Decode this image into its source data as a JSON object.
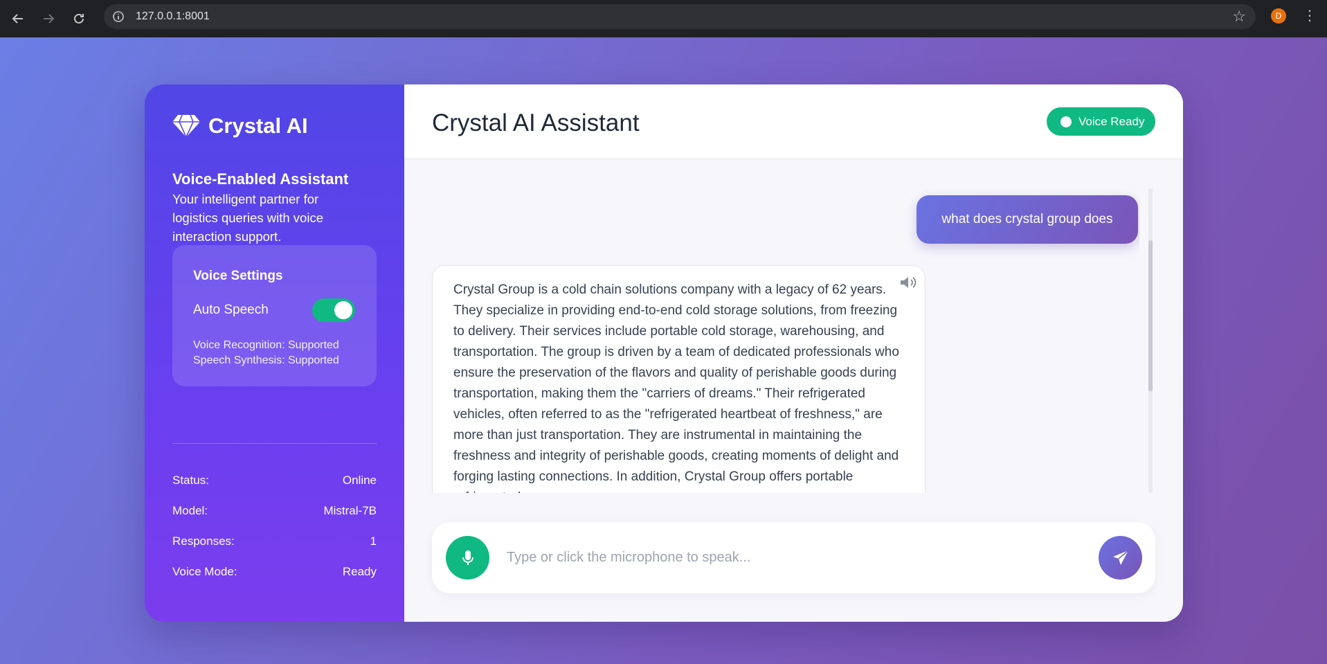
{
  "browser": {
    "url": "127.0.0.1:8001",
    "profile_initial": "D"
  },
  "sidebar": {
    "brand": "Crystal AI",
    "tagline_title": "Voice-Enabled Assistant",
    "tagline_desc": "Your intelligent partner for logistics queries with voice interaction support.",
    "voice_settings": {
      "title": "Voice Settings",
      "auto_speech_label": "Auto Speech",
      "auto_speech_on": true,
      "recognition_status": "Voice Recognition: Supported",
      "synthesis_status": "Speech Synthesis: Supported"
    },
    "stats": [
      {
        "label": "Status:",
        "value": "Online"
      },
      {
        "label": "Model:",
        "value": "Mistral-7B"
      },
      {
        "label": "Responses:",
        "value": "1"
      },
      {
        "label": "Voice Mode:",
        "value": "Ready"
      }
    ]
  },
  "main": {
    "title": "Crystal AI Assistant",
    "voice_badge": "Voice Ready"
  },
  "chat": {
    "messages": [
      {
        "role": "user",
        "text": "what does crystal group does"
      },
      {
        "role": "assistant",
        "text": "Crystal Group is a cold chain solutions company with a legacy of 62 years. They specialize in providing end-to-end cold storage solutions, from freezing to delivery. Their services include portable cold storage, warehousing, and transportation. The group is driven by a team of dedicated professionals who ensure the preservation of the flavors and quality of perishable goods during transportation, making them the \"carriers of dreams.\" Their refrigerated vehicles, often referred to as the \"refrigerated heartbeat of freshness,\" are more than just transportation. They are instrumental in maintaining the freshness and integrity of perishable goods, creating moments of delight and forging lasting connections. In addition, Crystal Group offers portable refrigerated"
      }
    ]
  },
  "input": {
    "placeholder": "Type or click the microphone to speak..."
  },
  "colors": {
    "accent_green": "#10b981",
    "sidebar_start": "#5146e6",
    "sidebar_end": "#7b3ded"
  }
}
